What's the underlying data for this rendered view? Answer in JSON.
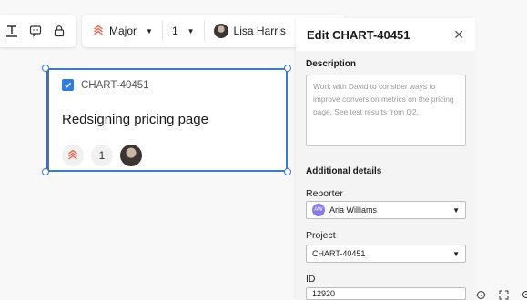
{
  "toolbar": {
    "priority_label": "Major",
    "estimate_value": "1",
    "assignee_name": "Lisa Harris"
  },
  "card": {
    "key": "CHART-40451",
    "title": "Redsigning pricing page",
    "estimate": "1",
    "checked": true
  },
  "panel": {
    "title": "Edit CHART-40451",
    "description_label": "Description",
    "description_text": "Work with David to consider ways to improve conversion metrics on the pricing page. See test results from Q2.",
    "additional_details_label": "Additional details",
    "reporter_label": "Reporter",
    "reporter_initials": "AW",
    "reporter_name": "Aria Williams",
    "project_label": "Project",
    "project_value": "CHART-40451",
    "id_label": "ID",
    "id_value": "12920"
  },
  "colors": {
    "accent": "#2f7de1",
    "priority": "#e8644a",
    "selection": "#3a7bd5",
    "reporter_avatar": "#8a7be6"
  },
  "icons": [
    "text-underline-icon",
    "comment-icon",
    "lock-icon",
    "priority-major-icon",
    "pencil-icon",
    "close-icon",
    "history-icon",
    "fit-screen-icon",
    "zoom-icon"
  ]
}
